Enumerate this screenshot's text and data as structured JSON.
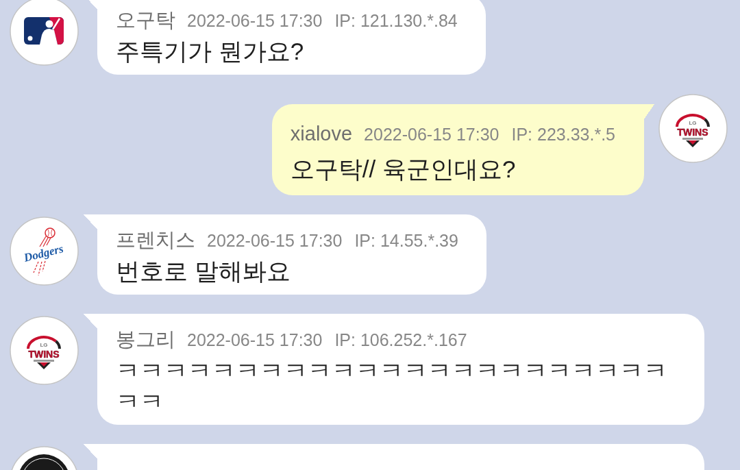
{
  "messages": [
    {
      "kind": "incoming",
      "avatar": {
        "kind": "mlb"
      },
      "username": "오구탁",
      "time": "2022-06-15 17:30",
      "ip": "IP: 121.130.*.84",
      "text": "주특기가 뭔가요?"
    },
    {
      "kind": "outgoing",
      "avatar": {
        "kind": "twins",
        "badge": "LG",
        "wordmark": "TWINS"
      },
      "username": "xialove",
      "time": "2022-06-15 17:30",
      "ip": "IP: 223.33.*.5",
      "text": "오구탁// 육군인대요?"
    },
    {
      "kind": "incoming",
      "avatar": {
        "kind": "dodgers",
        "wordmark": "Dodgers"
      },
      "username": "프렌치스",
      "time": "2022-06-15 17:30",
      "ip": "IP: 14.55.*.39",
      "text": "번호로 말해봐요"
    },
    {
      "kind": "incoming",
      "avatar": {
        "kind": "twins",
        "badge": "LG",
        "wordmark": "TWINS"
      },
      "username": "봉그리",
      "time": "2022-06-15 17:30",
      "ip": "IP: 106.252.*.167",
      "text": "ㅋㅋㅋㅋㅋㅋㅋㅋㅋㅋㅋㅋㅋㅋㅋㅋㅋㅋㅋㅋㅋㅋㅋㅋㅋ"
    },
    {
      "kind": "incoming",
      "avatar": {
        "kind": "emblem"
      }
    }
  ]
}
